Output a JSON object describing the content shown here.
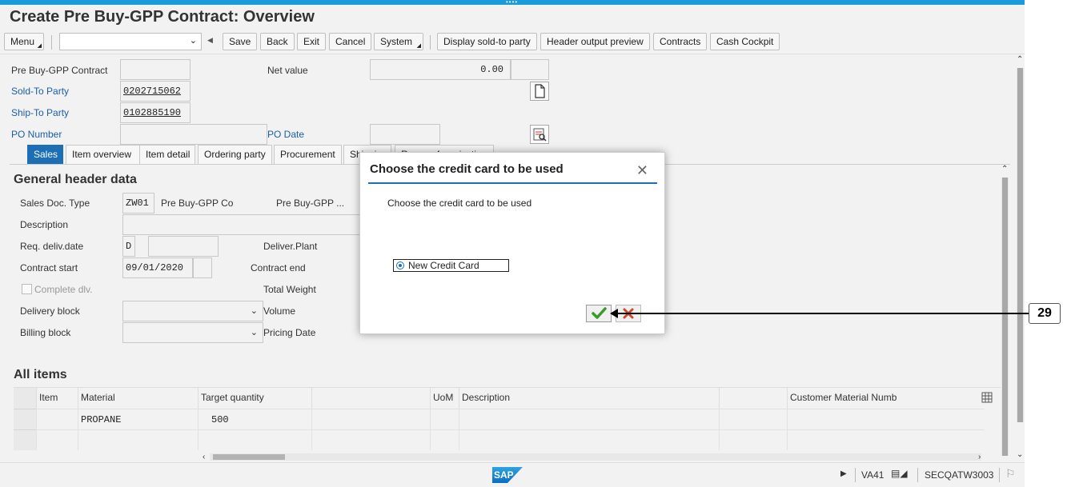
{
  "window": {
    "title": "Create Pre Buy-GPP Contract: Overview"
  },
  "toolbar": {
    "menu_label": "Menu",
    "command_value": "",
    "buttons": [
      "Save",
      "Back",
      "Exit",
      "Cancel",
      "System"
    ],
    "app_buttons": [
      "Display sold-to party",
      "Header output preview",
      "Contracts",
      "Cash Cockpit"
    ]
  },
  "header": {
    "contract_label": "Pre Buy-GPP Contract",
    "contract_value": "",
    "net_value_label": "Net value",
    "net_value": "0.00",
    "currency": "",
    "sold_to_label": "Sold-To Party",
    "sold_to_value": "0202715062",
    "ship_to_label": "Ship-To Party",
    "ship_to_value": "0102885190",
    "po_number_label": "PO Number",
    "po_number_value": "",
    "po_date_label": "PO Date",
    "po_date_value": ""
  },
  "tabs": [
    "Sales",
    "Item overview",
    "Item detail",
    "Ordering party",
    "Procurement",
    "Shipping",
    "Reason for rejection"
  ],
  "general": {
    "section_title": "General header data",
    "sales_doc_type_label": "Sales Doc. Type",
    "sales_doc_type_code": "ZW01",
    "sales_doc_type_desc": "Pre Buy-GPP Co",
    "sales_doc_type_desc2": "Pre Buy-GPP ...",
    "description_label": "Description",
    "description_value": "",
    "req_deliv_label": "Req. deliv.date",
    "req_deliv_type": "D",
    "req_deliv_value": "",
    "deliver_plant_label": "Deliver.Plant",
    "contract_start_label": "Contract start",
    "contract_start_value": "09/01/2020",
    "contract_end_label": "Contract end",
    "complete_dlv_label": "Complete dlv.",
    "total_weight_label": "Total Weight",
    "delivery_block_label": "Delivery block",
    "volume_label": "Volume",
    "billing_block_label": "Billing block",
    "pricing_date_label": "Pricing Date"
  },
  "items": {
    "section_title": "All items",
    "columns": [
      "Item",
      "Material",
      "Target quantity",
      "UoM",
      "Description",
      "Customer Material Numb"
    ],
    "rows": [
      {
        "item": "",
        "material": "PROPANE",
        "qty": "500",
        "uom": "",
        "description": ""
      },
      {
        "item": "",
        "material": "",
        "qty": "",
        "uom": "",
        "description": ""
      }
    ]
  },
  "status": {
    "transaction": "VA41",
    "system": "SECQATW3003"
  },
  "dialog": {
    "title": "Choose the credit card to be used",
    "message": "Choose the credit card to be used",
    "option": "New Credit Card"
  },
  "callout": {
    "number": "29"
  },
  "colors": {
    "accent": "#1c6fb5",
    "top_strip": "#1a9cdb",
    "ok_green": "#3a9a2a",
    "cancel_red": "#d2462e"
  }
}
